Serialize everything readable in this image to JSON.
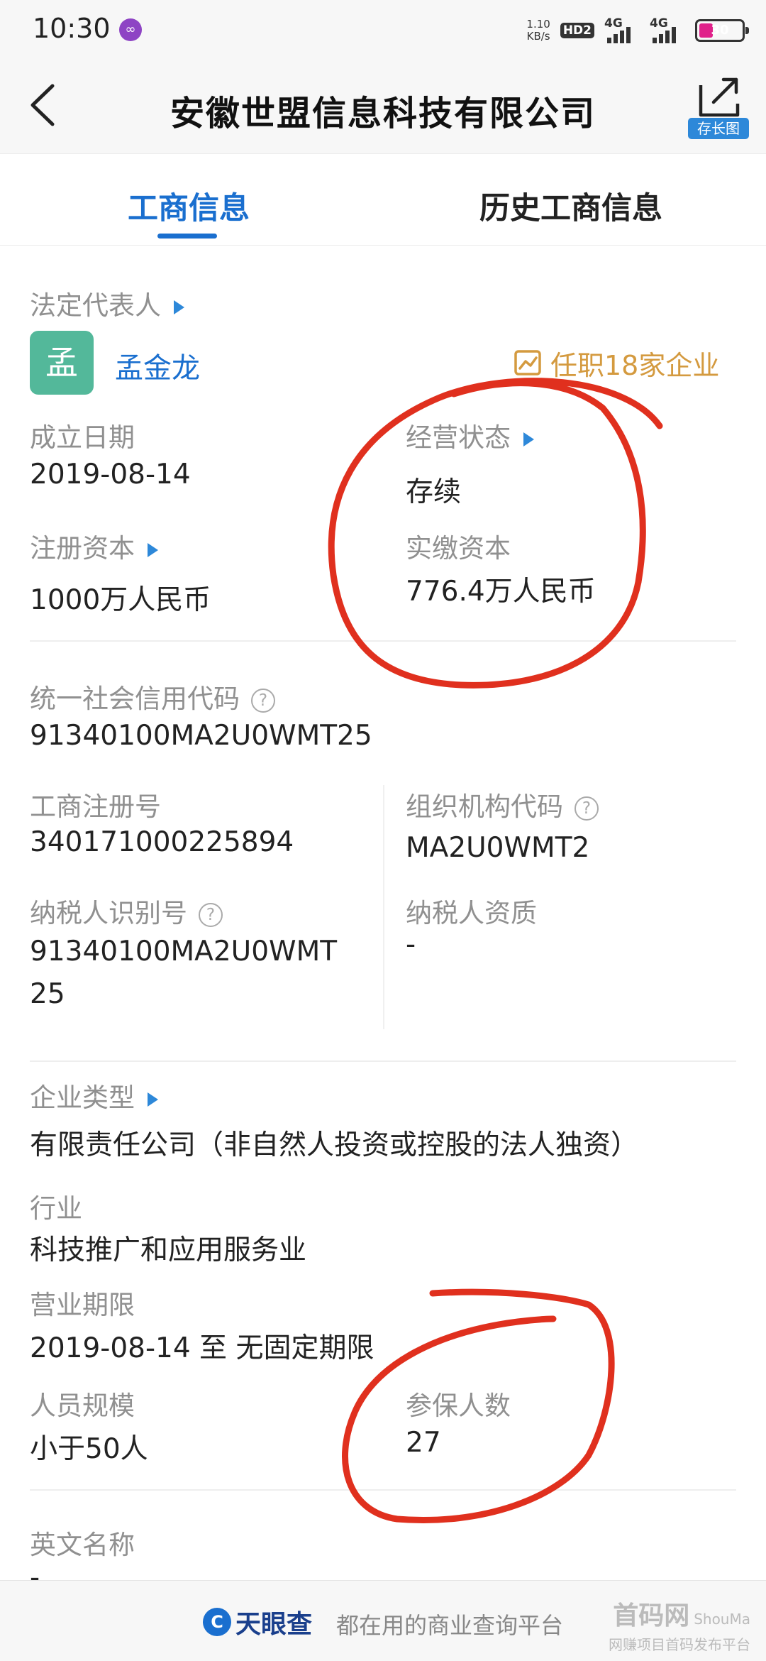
{
  "status_bar": {
    "time": "10:30",
    "net_speed_value": "1.10",
    "net_speed_unit": "KB/s",
    "hd_label": "HD2",
    "signal1": "4G",
    "signal2": "4G",
    "battery": "30"
  },
  "header": {
    "title": "安徽世盟信息科技有限公司",
    "save_long_label": "存长图"
  },
  "tabs": [
    {
      "label": "工商信息",
      "active": true
    },
    {
      "label": "历史工商信息",
      "active": false
    }
  ],
  "legal_rep": {
    "label": "法定代表人",
    "avatar_char": "孟",
    "name": "孟金龙",
    "jobs": "任职18家企业"
  },
  "fields": {
    "established_label": "成立日期",
    "established_value": "2019-08-14",
    "status_label": "经营状态",
    "status_value": "存续",
    "registered_capital_label": "注册资本",
    "registered_capital_value": "1000万人民币",
    "paid_capital_label": "实缴资本",
    "paid_capital_value": "776.4万人民币",
    "credit_code_label": "统一社会信用代码",
    "credit_code_value": "91340100MA2U0WMT25",
    "reg_no_label": "工商注册号",
    "reg_no_value": "340171000225894",
    "org_code_label": "组织机构代码",
    "org_code_value": "MA2U0WMT2",
    "tax_id_label": "纳税人识别号",
    "tax_id_value_line1": "91340100MA2U0WMT",
    "tax_id_value_line2": "25",
    "tax_qual_label": "纳税人资质",
    "tax_qual_value": "-",
    "company_type_label": "企业类型",
    "company_type_value": "有限责任公司（非自然人投资或控股的法人独资）",
    "industry_label": "行业",
    "industry_value": "科技推广和应用服务业",
    "term_label": "营业期限",
    "term_value": "2019-08-14 至 无固定期限",
    "staff_size_label": "人员规模",
    "staff_size_value": "小于50人",
    "insured_label": "参保人数",
    "insured_value": "27",
    "english_name_label": "英文名称",
    "english_name_value": "-"
  },
  "bottom_bar": {
    "brand_logo_char": "C",
    "brand_name": "天眼查",
    "slogan": "都在用的商业查询平台"
  },
  "watermark": {
    "line1": "首码网",
    "line1_latin": "ShouMa",
    "line2": "网赚项目首码发布平台"
  },
  "colors": {
    "accent": "#1a6fcf",
    "annotation": "#e0301e",
    "jobs_badge": "#d49a3f"
  }
}
